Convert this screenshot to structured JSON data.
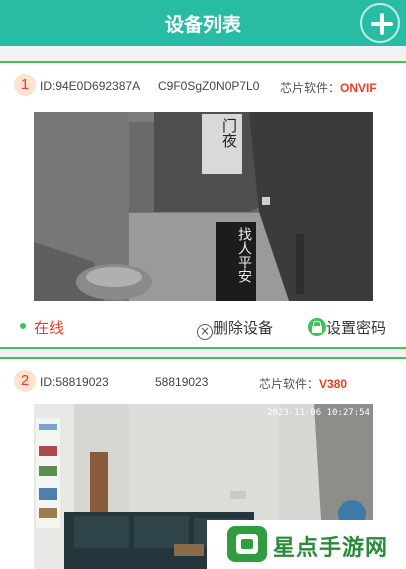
{
  "header": {
    "title": "设备列表"
  },
  "devices": [
    {
      "index": "1",
      "id": "ID:94E0D692387A",
      "code": "C9F0SgZ0N0P7L0",
      "chip_label": "芯片软件：",
      "chip_value": "ONVIF",
      "status": "在线",
      "delete_label": "删除设备",
      "password_label": "设置密码",
      "camera_sign_text": "门夜",
      "camera_board_text": "找人平安"
    },
    {
      "index": "2",
      "id": "ID:58819023",
      "code": "58819023",
      "chip_label": "芯片软件：",
      "chip_value": "V380",
      "camera_timestamp": "2023-11-06 10:27:54"
    }
  ],
  "watermark": {
    "text": "星点手游网"
  },
  "colors": {
    "header": "#29bca5",
    "accent_green": "#3ec35b",
    "accent_red": "#e63f24"
  }
}
